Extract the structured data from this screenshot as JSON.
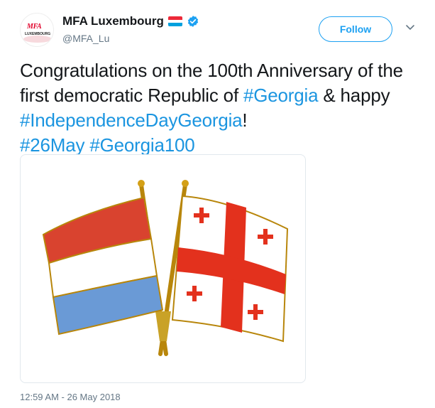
{
  "account": {
    "display_name": "MFA Luxembourg",
    "handle": "@MFA_Lu",
    "avatar_text": "MFA",
    "avatar_subtext": "LUXEMBOURG",
    "name_flag_icon": "luxembourg-flag-icon",
    "verified_icon": "verified-badge-icon",
    "verified_color": "#1da1f2"
  },
  "actions": {
    "follow_label": "Follow",
    "menu_icon": "chevron-down-icon"
  },
  "tweet": {
    "text_1": "Congratulations on the 100th Anniversary of the first democratic Republic of ",
    "tag_1": "#Georgia",
    "text_2": " & happy ",
    "tag_2": "#IndependenceDayGeorgia",
    "text_3": "!",
    "tag_3": "#26May",
    "tag_4": "#Georgia100",
    "hashtag_color": "#1b95e0"
  },
  "media": {
    "image_icon": "crossed-flags-pin-image"
  },
  "timestamp": "12:59 AM - 26 May 2018"
}
